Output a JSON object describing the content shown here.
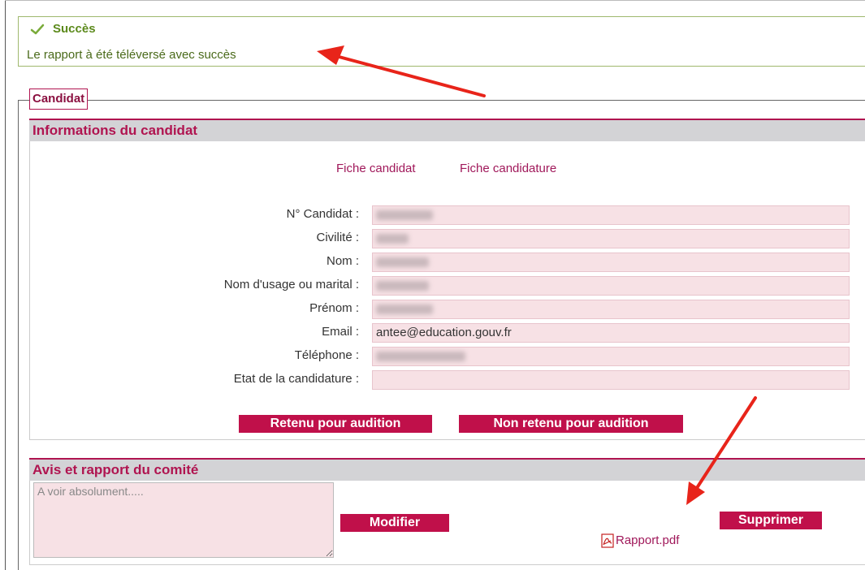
{
  "success": {
    "title": "Succès",
    "message": "Le rapport à été téléversé avec succès",
    "icon": "check-icon",
    "color": "#5c8a1c"
  },
  "fieldset": {
    "legend": "Candidat"
  },
  "candidate_section": {
    "header": "Informations du candidat",
    "links": {
      "fiche_candidat": "Fiche candidat",
      "fiche_candidature": "Fiche candidature"
    },
    "fields": [
      {
        "label": "N° Candidat :",
        "value": ""
      },
      {
        "label": "Civilité :",
        "value": ""
      },
      {
        "label": "Nom :",
        "value": ""
      },
      {
        "label": "Nom d'usage ou marital :",
        "value": ""
      },
      {
        "label": "Prénom :",
        "value": ""
      },
      {
        "label": "Email :",
        "value": "antee@education.gouv.fr"
      },
      {
        "label": "Téléphone :",
        "value": ""
      },
      {
        "label": "Etat de la candidature :",
        "value": ""
      }
    ],
    "buttons": {
      "retenu": "Retenu pour audition",
      "non_retenu": "Non retenu pour audition"
    }
  },
  "avis_section": {
    "header": "Avis et rapport du comité",
    "textarea_value": "A voir absolument.....",
    "modifier_label": "Modifier",
    "rapport_link": "Rapport.pdf",
    "supprimer_label": "Supprimer",
    "pdf_icon": "pdf-icon"
  },
  "colors": {
    "accent": "#b01450",
    "button_bg": "#c0104a",
    "input_bg": "#f7e1e5",
    "header_bg": "#d3d3d6",
    "annotation_arrow": "#e8241a"
  }
}
